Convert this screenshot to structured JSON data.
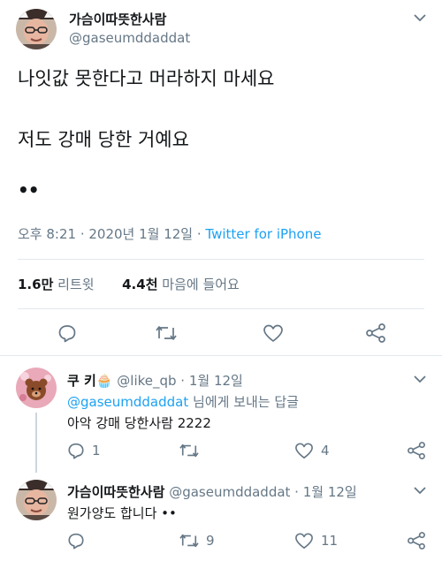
{
  "main": {
    "author_name": "가슴이따뜻한사람",
    "author_handle": "@gaseumddaddat",
    "lines": [
      "나잇값 못한다고 머라하지 마세요",
      "저도 강매 당한 거예요"
    ],
    "trailing": "••",
    "timestamp": "오후 8:21 · 2020년 1월 12일 · ",
    "source": "Twitter for iPhone",
    "retweets_count": "1.6만",
    "retweets_label": "리트윗",
    "likes_count": "4.4천",
    "likes_label": "마음에 들어요"
  },
  "reply1": {
    "name": "쿠 키🧁",
    "handle_date": "@like_qb · 1월 12일",
    "reply_to_handle": "@gaseumddaddat",
    "reply_to_suffix": "님에게 보내는 답글",
    "text": "아악 강매 당한사람 2222",
    "reply_count": "1",
    "like_count": "4"
  },
  "reply2": {
    "name": "가슴이따뜻한사람",
    "handle_date": "@gaseumddaddat · 1월 12일",
    "text": "원가양도 합니다 ••",
    "retweet_count": "9",
    "like_count": "11"
  },
  "icons": {
    "reply": "reply-icon",
    "retweet": "retweet-icon",
    "like": "heart-icon",
    "share": "share-icon",
    "more": "chevron-down-icon"
  },
  "colors": {
    "accent": "#1da1f2",
    "secondary": "#657786",
    "text": "#14171a",
    "divider": "#e1e8ed"
  }
}
